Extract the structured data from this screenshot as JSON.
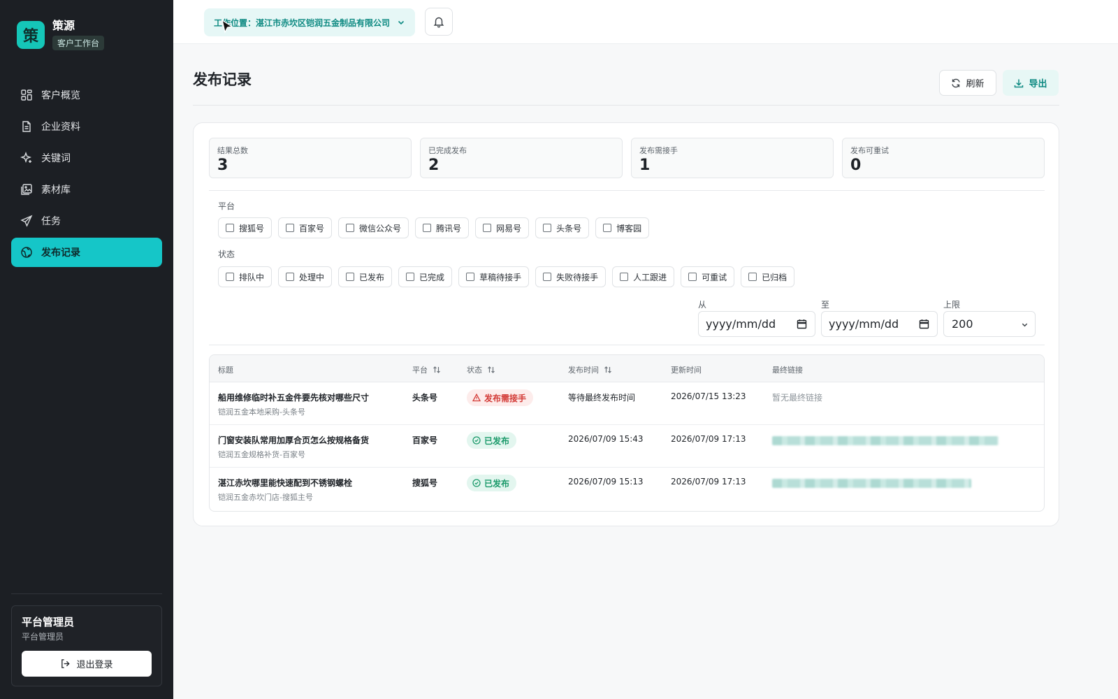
{
  "brand": {
    "logo_char": "策",
    "name": "策源",
    "badge": "客户工作台"
  },
  "sidebar": {
    "items": [
      {
        "label": "客户概览",
        "icon": "dashboard-icon",
        "active": false
      },
      {
        "label": "企业资料",
        "icon": "document-icon",
        "active": false
      },
      {
        "label": "关键词",
        "icon": "sparkle-icon",
        "active": false
      },
      {
        "label": "素材库",
        "icon": "gallery-icon",
        "active": false
      },
      {
        "label": "任务",
        "icon": "send-icon",
        "active": false
      },
      {
        "label": "发布记录",
        "icon": "globe-icon",
        "active": true
      }
    ],
    "user": {
      "name": "平台管理员",
      "role": "平台管理员",
      "logout_label": "退出登录"
    }
  },
  "topbar": {
    "workspace_label": "工作位置：湛江市赤坎区铠润五金制品有限公司"
  },
  "page": {
    "title": "发布记录",
    "refresh_label": "刷新",
    "export_label": "导出"
  },
  "stats": [
    {
      "label": "结果总数",
      "value": "3"
    },
    {
      "label": "已完成发布",
      "value": "2"
    },
    {
      "label": "发布需接手",
      "value": "1"
    },
    {
      "label": "发布可重试",
      "value": "0"
    }
  ],
  "filters": {
    "platform_label": "平台",
    "platforms": [
      "搜狐号",
      "百家号",
      "微信公众号",
      "腾讯号",
      "网易号",
      "头条号",
      "博客园"
    ],
    "status_label": "状态",
    "statuses": [
      "排队中",
      "处理中",
      "已发布",
      "已完成",
      "草稿待接手",
      "失败待接手",
      "人工跟进",
      "可重试",
      "已归档"
    ],
    "from_label": "从",
    "from_value": "yyyy/mm/dd",
    "to_label": "至",
    "to_value": "yyyy/mm/dd",
    "limit_label": "上限",
    "limit_value": "200"
  },
  "table": {
    "columns": [
      "标题",
      "平台",
      "状态",
      "发布时间",
      "更新时间",
      "最终链接"
    ],
    "rows": [
      {
        "title": "船用维修临时补五金件要先核对哪些尺寸",
        "sub": "铠润五金本地采购-头条号",
        "platform": "头条号",
        "status": "发布需接手",
        "status_type": "warn",
        "published": "等待最终发布时间",
        "updated": "2026/07/15 13:23",
        "link": "暂无最终链接"
      },
      {
        "title": "门窗安装队常用加厚合页怎么按规格备货",
        "sub": "铠润五金规格补货-百家号",
        "platform": "百家号",
        "status": "已发布",
        "status_type": "ok",
        "published": "2026/07/09 15:43",
        "updated": "2026/07/09 17:13",
        "link": ""
      },
      {
        "title": "湛江赤坎哪里能快速配到不锈钢螺栓",
        "sub": "铠润五金赤坎门店-搜狐主号",
        "platform": "搜狐号",
        "status": "已发布",
        "status_type": "ok",
        "published": "2026/07/09 15:13",
        "updated": "2026/07/09 17:13",
        "link": ""
      }
    ]
  },
  "colors": {
    "accent": "#15c6c8",
    "sidebar_bg": "#1c1f24",
    "warn": "#d33a36",
    "ok": "#1c9a6b"
  }
}
